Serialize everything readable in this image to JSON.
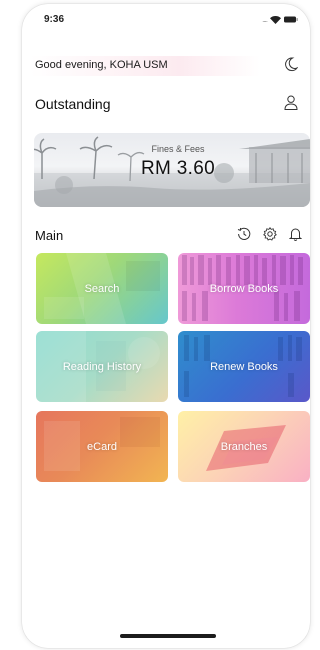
{
  "status_bar": {
    "time": "9:36",
    "signal": "....",
    "icons": [
      "wifi-icon",
      "battery-icon"
    ]
  },
  "header": {
    "greeting": "Good evening, KOHA USM",
    "theme_icon": "moon-icon"
  },
  "outstanding": {
    "title": "Outstanding",
    "profile_icon": "user-icon",
    "fines_label": "Fines & Fees",
    "fines_amount": "RM 3.60"
  },
  "main": {
    "title": "Main",
    "icons": [
      "history-icon",
      "gear-icon",
      "bell-icon"
    ],
    "tiles": [
      {
        "label": "Search",
        "color_from": "#c5e85e",
        "color_to": "#66c7cc"
      },
      {
        "label": "Borrow Books",
        "color_from": "#ef9ad8",
        "color_to": "#c46adc"
      },
      {
        "label": "Reading History",
        "color_from": "#8fdcd0",
        "color_to": "#e9d9b0"
      },
      {
        "label": "Renew Books",
        "color_from": "#2f8ecd",
        "color_to": "#5a58c9"
      },
      {
        "label": "eCard",
        "color_from": "#e6765d",
        "color_to": "#f2b552"
      },
      {
        "label": "Branches",
        "color_from": "#fff0a6",
        "color_to": "#f9b0c4"
      }
    ]
  }
}
